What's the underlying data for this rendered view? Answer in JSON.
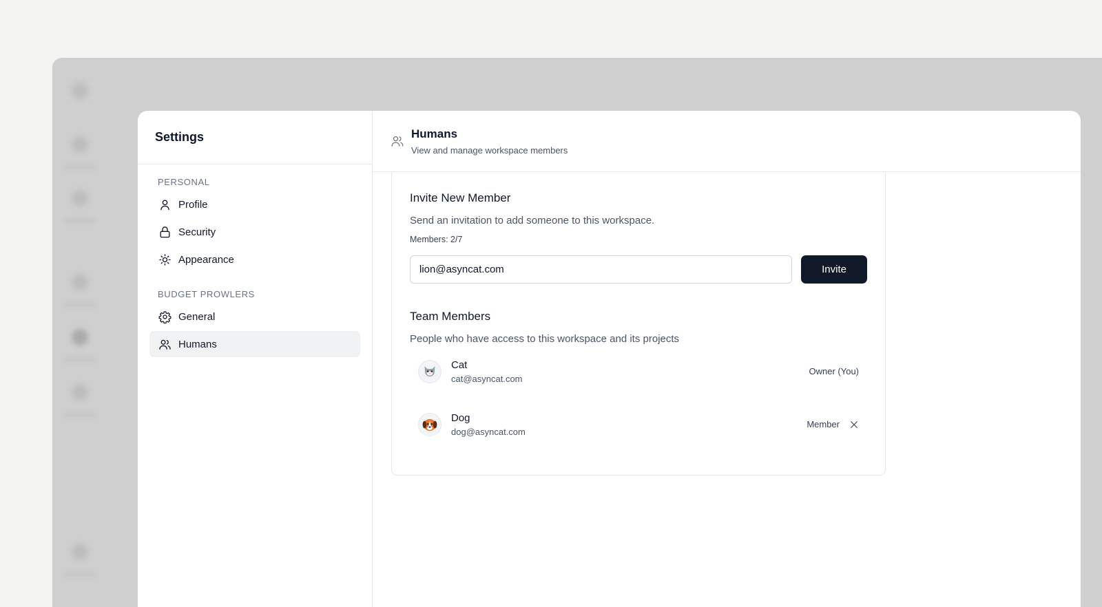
{
  "settings": {
    "title": "Settings",
    "sections": [
      {
        "label": "PERSONAL",
        "items": [
          {
            "label": "Profile",
            "icon": "user-icon"
          },
          {
            "label": "Security",
            "icon": "lock-icon"
          },
          {
            "label": "Appearance",
            "icon": "sun-icon"
          }
        ]
      },
      {
        "label": "BUDGET PROWLERS",
        "items": [
          {
            "label": "General",
            "icon": "gear-icon"
          },
          {
            "label": "Humans",
            "icon": "users-icon",
            "active": true
          }
        ]
      }
    ]
  },
  "header": {
    "title": "Humans",
    "subtitle": "View and manage workspace members",
    "icon": "users-icon"
  },
  "invite": {
    "title": "Invite New Member",
    "description": "Send an invitation to add someone to this workspace.",
    "members_count": "Members: 2/7",
    "input_value": "lion@asyncat.com",
    "button_label": "Invite"
  },
  "team": {
    "title": "Team Members",
    "description": "People who have access to this workspace and its projects",
    "members": [
      {
        "name": "Cat",
        "email": "cat@asyncat.com",
        "role": "Owner (You)",
        "avatar": "cat-avatar-icon",
        "removable": false
      },
      {
        "name": "Dog",
        "email": "dog@asyncat.com",
        "role": "Member",
        "avatar": "dog-avatar-icon",
        "removable": true
      }
    ]
  },
  "colors": {
    "primary_button": "#111827",
    "active_item_bg": "#f1f2f4",
    "backdrop": "#cfcfcf"
  }
}
